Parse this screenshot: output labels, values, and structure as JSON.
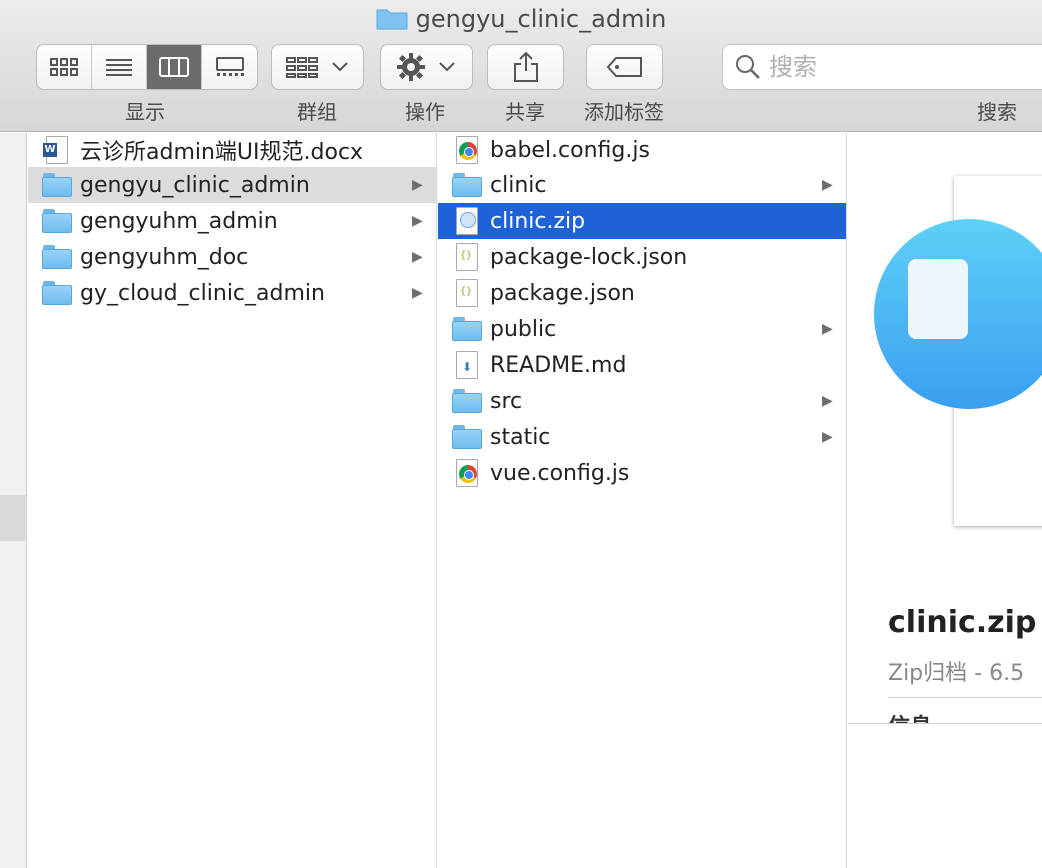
{
  "window": {
    "title": "gengyu_clinic_admin"
  },
  "toolbar": {
    "view_label": "显示",
    "group_label": "群组",
    "action_label": "操作",
    "share_label": "共享",
    "tag_label": "添加标签",
    "search_label": "搜索",
    "search_placeholder": "搜索"
  },
  "column1": {
    "items": [
      {
        "label": "云诊所admin端UI规范.docx",
        "type": "docx"
      },
      {
        "label": "gengyu_clinic_admin",
        "type": "folder",
        "selected": true
      },
      {
        "label": "gengyuhm_admin",
        "type": "folder"
      },
      {
        "label": "gengyuhm_doc",
        "type": "folder"
      },
      {
        "label": "gy_cloud_clinic_admin",
        "type": "folder"
      }
    ]
  },
  "column2": {
    "items": [
      {
        "label": "babel.config.js",
        "type": "js"
      },
      {
        "label": "clinic",
        "type": "folder"
      },
      {
        "label": "clinic.zip",
        "type": "zip",
        "selected": true
      },
      {
        "label": "package-lock.json",
        "type": "json"
      },
      {
        "label": "package.json",
        "type": "json"
      },
      {
        "label": "public",
        "type": "folder"
      },
      {
        "label": "README.md",
        "type": "md"
      },
      {
        "label": "src",
        "type": "folder"
      },
      {
        "label": "static",
        "type": "folder"
      },
      {
        "label": "vue.config.js",
        "type": "js"
      }
    ]
  },
  "preview": {
    "filename": "clinic.zip",
    "kind": "Zip归档 - 6.5",
    "info_heading": "信息"
  },
  "colors": {
    "selection_blue": "#1f62d8",
    "selection_gray": "#dcdcdc",
    "folder_blue": "#6fbcf0"
  }
}
